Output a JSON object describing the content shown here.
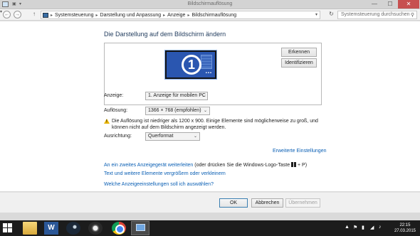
{
  "window": {
    "title": "Bildschirmauflösung",
    "minimize_glyph": "—",
    "maximize_glyph": "☐",
    "close_glyph": "✕"
  },
  "addressbar": {
    "back_glyph": "←",
    "forward_glyph": "→",
    "up_glyph": "↑",
    "breadcrumb": [
      "Systemsteuerung",
      "Darstellung und Anpassung",
      "Anzeige",
      "Bildschirmauflösung"
    ],
    "separator": "▸",
    "search_placeholder": "Systemsteuerung durchsuchen"
  },
  "main": {
    "heading": "Die Darstellung auf dem Bildschirm ändern",
    "preview": {
      "monitor_number": "1",
      "identify_button": "Erkennen",
      "detect_button": "Identifizieren"
    },
    "display_label": "Anzeige:",
    "display_value": "1. Anzeige für mobilen PC",
    "resolution_label": "Auflösung:",
    "resolution_value": "1366 × 768 (empfohlen)",
    "warning": "Die Auflösung ist niedriger als 1200 x 900. Einige Elemente sind möglicherweise zu groß, und können nicht auf dem Bildschirm angezeigt werden.",
    "orientation_label": "Ausrichtung:",
    "orientation_value": "Querformat",
    "advanced_link": "Erweiterte Einstellungen",
    "project_link": "An ein zweites Anzeigegerät weiterleiten",
    "project_hint_pre": "(oder drücken Sie die Windows-Logo-Taste",
    "project_hint_post": "+ P)",
    "text_size_link": "Text und weitere Elemente vergrößern oder verkleinern",
    "which_settings_link": "Welche Anzeigeeinstellungen soll ich auswählen?"
  },
  "footer": {
    "ok": "OK",
    "cancel": "Abbrechen",
    "apply": "Übernehmen"
  },
  "taskbar": {
    "word_label": "W",
    "tray_glyphs": [
      "▲",
      "⚑",
      "▮",
      "◢",
      "♪"
    ],
    "time": "22:15",
    "date": "27.03.2015"
  },
  "colors": {
    "link": "#0a5fb4",
    "heading": "#1e395b",
    "monitor": "#2a56b0",
    "close_button": "#c75050",
    "warning": "#e8b400"
  }
}
